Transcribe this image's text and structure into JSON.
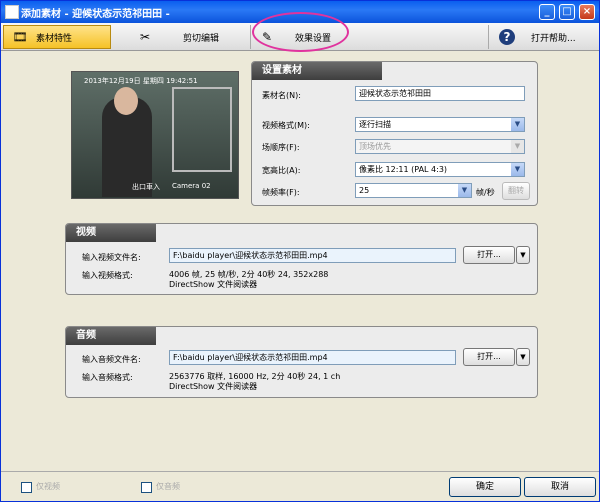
{
  "window": {
    "title": "添加素材 - 迎候状态示范祁田田 -"
  },
  "tabs": [
    {
      "label": "素材特性",
      "icon": "film-icon"
    },
    {
      "label": "剪切编辑",
      "icon": "scissors-icon"
    },
    {
      "label": "效果设置",
      "icon": "effects-icon"
    },
    {
      "label": "打开帮助...",
      "icon": "help-icon"
    }
  ],
  "preview": {
    "timestamp": "2013年12月19日 星期四 19:42:51",
    "camera_label": "Camera 02",
    "overlay": "出口車入"
  },
  "settings": {
    "header": "设置素材",
    "name_label": "素材名(N):",
    "name_value": "迎候状态示范祁田田",
    "video_format_label": "视频格式(M):",
    "video_format_value": "逐行扫描",
    "field_order_label": "场顺序(F):",
    "field_order_value": "顶场优先",
    "aspect_label": "宽高比(A):",
    "aspect_value": "像素比 12:11 (PAL 4:3)",
    "framerate_label": "帧频率(F):",
    "framerate_value": "25",
    "framerate_unit": "帧/秒",
    "framerate_btn": "翻转"
  },
  "video": {
    "header": "视频",
    "file_label": "输入视频文件名:",
    "file_value": "F:\\baidu player\\迎候状态示范祁田田.mp4",
    "open_label": "打开...",
    "format_label": "输入视频格式:",
    "format_line1": "4006 帧, 25 帧/秒, 2分 40秒 24, 352x288",
    "format_line2": "DirectShow 文件阅读器"
  },
  "audio": {
    "header": "音频",
    "file_label": "输入音频文件名:",
    "file_value": "F:\\baidu player\\迎候状态示范祁田田.mp4",
    "open_label": "打开...",
    "format_label": "输入音频格式:",
    "format_line1": "2563776 取样, 16000 Hz, 2分 40秒 24, 1 ch",
    "format_line2": "DirectShow 文件阅读器"
  },
  "footer": {
    "check1": "仅视频",
    "check2": "仅音频",
    "ok": "确定",
    "cancel": "取消"
  }
}
